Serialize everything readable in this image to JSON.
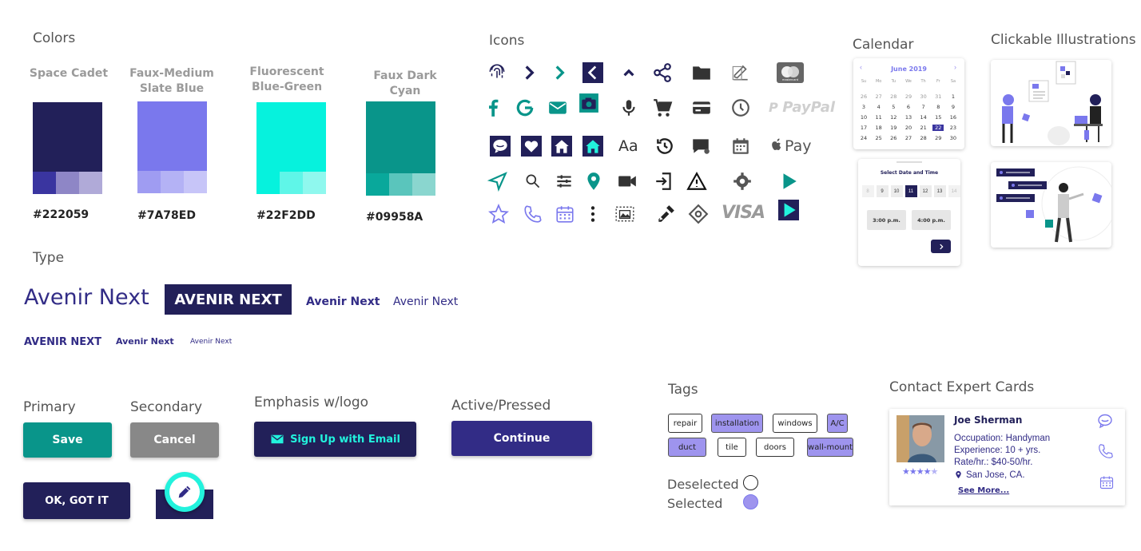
{
  "sections": {
    "colors": "Colors",
    "icons": "Icons",
    "calendar": "Calendar",
    "illustrations": "Clickable Illustrations",
    "type": "Type",
    "tags": "Tags",
    "contact": "Contact Expert Cards"
  },
  "swatches": [
    {
      "name": "Space Cadet",
      "hex": "#222059",
      "color": "#222059",
      "tints": [
        "#3a35a0",
        "#8e86c6",
        "#b0aad8"
      ]
    },
    {
      "name": "Faux-Medium Slate Blue",
      "hex": "#7A78ED",
      "color": "#7a78ed",
      "tints": [
        "#9f9cf2",
        "#b4b2f5",
        "#c7c5f8"
      ]
    },
    {
      "name": "Fluorescent Blue-Green",
      "hex": "#22F2DD",
      "color": "#06f2dd",
      "tints": [
        "#06f2dd",
        "#5ff6e8",
        "#8ff8ee"
      ]
    },
    {
      "name": "Faux Dark Cyan",
      "hex": "#09958A",
      "color": "#09958a",
      "tints": [
        "#09a89b",
        "#5ac5bc",
        "#8ad6cf"
      ]
    }
  ],
  "type": {
    "sample_large": "Avenir Next",
    "sample_caps_box": "AVENIR NEXT",
    "sample_bold": "Avenir Next",
    "sample_regular": "Avenir Next",
    "sample_caps_small": "AVENIR NEXT",
    "sample_bold_small": "Avenir Next",
    "sample_tiny": "Avenir Next"
  },
  "calendar": {
    "month": "June 2019",
    "weekdays": [
      "Su",
      "Mo",
      "Tu",
      "We",
      "Th",
      "Fr",
      "Sa"
    ],
    "weeks": [
      [
        "26",
        "27",
        "28",
        "29",
        "30",
        "31",
        "1"
      ],
      [
        "3",
        "4",
        "5",
        "6",
        "7",
        "8",
        "9"
      ],
      [
        "10",
        "11",
        "12",
        "13",
        "14",
        "15",
        "16"
      ],
      [
        "17",
        "18",
        "19",
        "20",
        "21",
        "22",
        "23"
      ],
      [
        "24",
        "25",
        "26",
        "27",
        "28",
        "29",
        "30"
      ]
    ],
    "selected_day": "22",
    "picker_title": "Select Date and Time",
    "picker_days": [
      "8",
      "9",
      "10",
      "11",
      "12",
      "13",
      "14"
    ],
    "picker_selected": "11",
    "times": [
      "3:00 p.m.",
      "4:00 p.m."
    ],
    "next_icon": "chevron-right-icon"
  },
  "buttons": {
    "primary_label": "Primary",
    "secondary_label": "Secondary",
    "emphasis_label": "Emphasis w/logo",
    "active_label": "Active/Pressed",
    "save": "Save",
    "cancel": "Cancel",
    "signup": "Sign Up with Email",
    "continue": "Continue",
    "ok": "OK, GOT IT"
  },
  "tags": {
    "items": [
      {
        "label": "repair",
        "selected": false
      },
      {
        "label": "installation",
        "selected": true
      },
      {
        "label": "windows",
        "selected": false
      },
      {
        "label": "A/C",
        "selected": true
      },
      {
        "label": "duct",
        "selected": true
      },
      {
        "label": "tile",
        "selected": false
      },
      {
        "label": "doors",
        "selected": false
      },
      {
        "label": "wall-mount",
        "selected": true
      }
    ],
    "deselected": "Deselected",
    "selected": "Selected"
  },
  "contact": {
    "name": "Joe Sherman",
    "occupation": "Occupation: Handyman",
    "experience": "Experience: 10 + yrs.",
    "rate": "Rate/hr.: $40-50/hr.",
    "location": "San Jose, CA.",
    "see_more": "See More...",
    "rating": 3.5
  },
  "icons": {
    "paypal": "PayPal",
    "applepay": "Pay",
    "visa": "VISA",
    "font_sample": "Aa",
    "mastercard": "mastercard"
  },
  "colors": {
    "navy": "#222059",
    "slate": "#7a78ed",
    "teal": "#09958a",
    "aqua": "#22f2dd",
    "press": "#322c86"
  }
}
